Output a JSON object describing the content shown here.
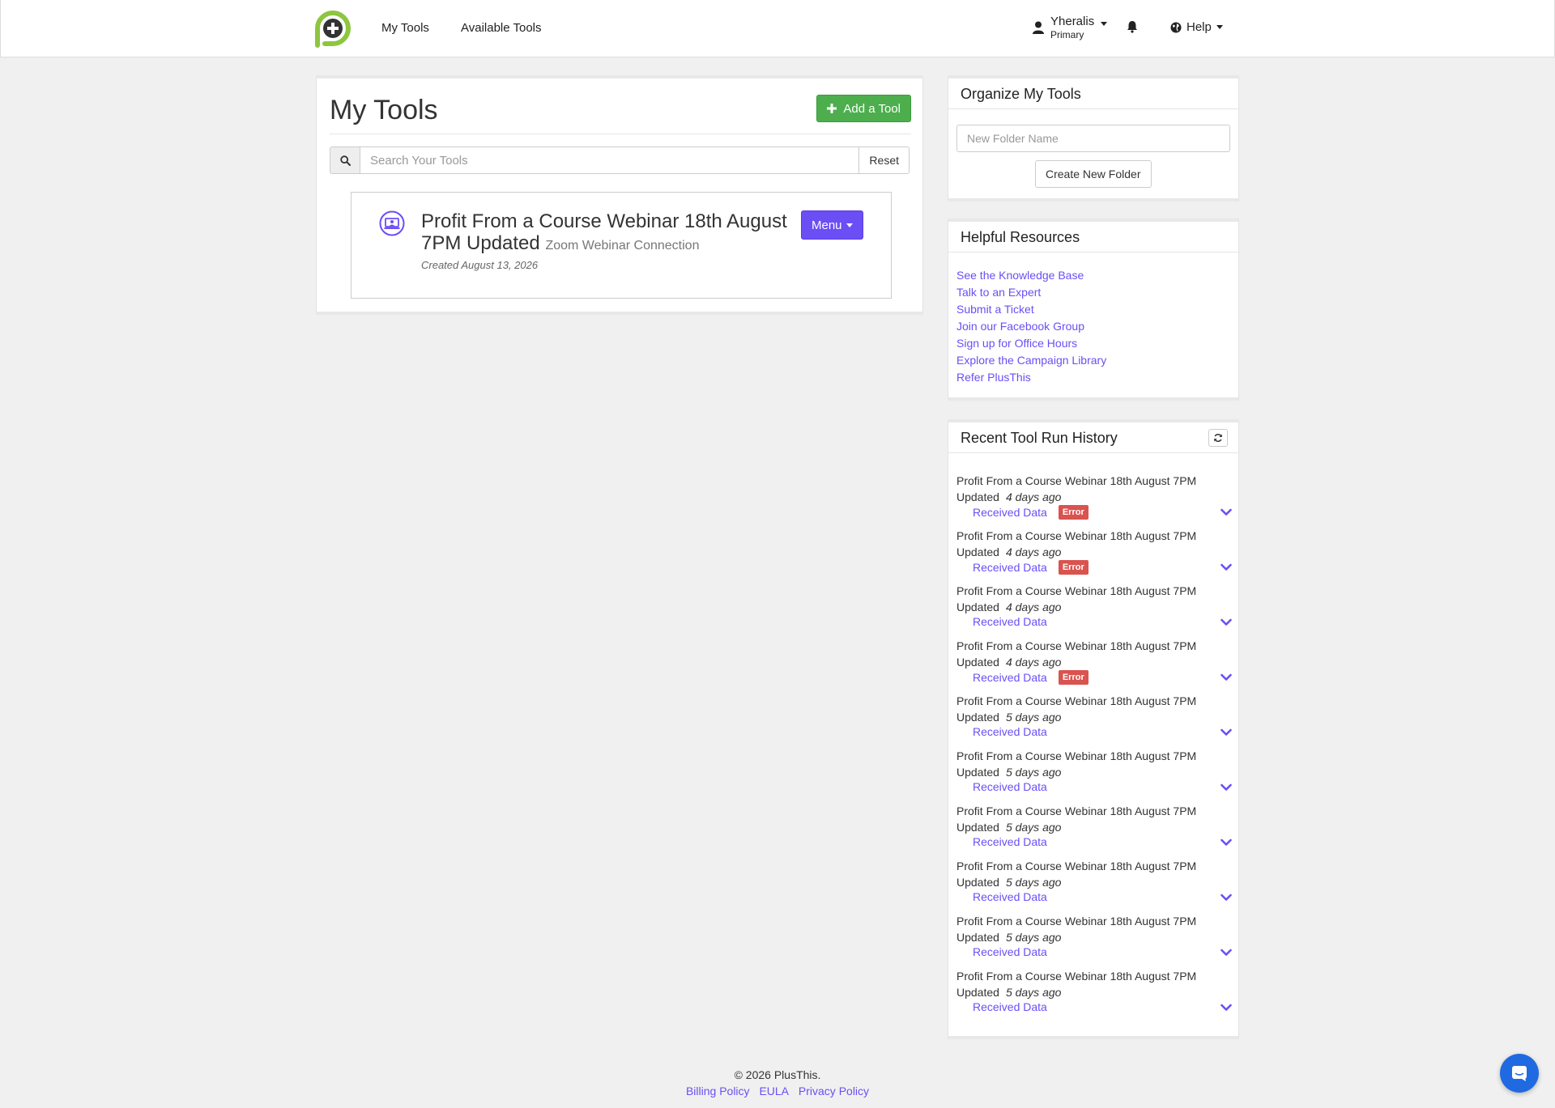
{
  "nav": {
    "my_tools": "My Tools",
    "available_tools": "Available Tools",
    "user_name": "Yheralis",
    "user_role": "Primary",
    "help": "Help"
  },
  "main": {
    "title": "My Tools",
    "add_tool": "Add a Tool",
    "search_placeholder": "Search Your Tools",
    "reset": "Reset",
    "tool": {
      "name": "Profit From a Course Webinar 18th August 7PM Updated",
      "type": "Zoom Webinar Connection",
      "created": "Created August 13, 2026",
      "menu": "Menu"
    }
  },
  "organize": {
    "title": "Organize My Tools",
    "folder_placeholder": "New Folder Name",
    "create_button": "Create New Folder"
  },
  "resources": {
    "title": "Helpful Resources",
    "links": [
      "See the Knowledge Base",
      "Talk to an Expert",
      "Submit a Ticket",
      "Join our Facebook Group",
      "Sign up for Office Hours",
      "Explore the Campaign Library",
      "Refer PlusThis"
    ]
  },
  "history": {
    "title": "Recent Tool Run History",
    "runs": [
      {
        "name": "Profit From a Course Webinar 18th August 7PM Updated",
        "time": "4 days ago",
        "status": "Received Data",
        "badge": "Error"
      },
      {
        "name": "Profit From a Course Webinar 18th August 7PM Updated",
        "time": "4 days ago",
        "status": "Received Data",
        "badge": "Error"
      },
      {
        "name": "Profit From a Course Webinar 18th August 7PM Updated",
        "time": "4 days ago",
        "status": "Received Data",
        "badge": ""
      },
      {
        "name": "Profit From a Course Webinar 18th August 7PM Updated",
        "time": "4 days ago",
        "status": "Received Data",
        "badge": "Error"
      },
      {
        "name": "Profit From a Course Webinar 18th August 7PM Updated",
        "time": "5 days ago",
        "status": "Received Data",
        "badge": ""
      },
      {
        "name": "Profit From a Course Webinar 18th August 7PM Updated",
        "time": "5 days ago",
        "status": "Received Data",
        "badge": ""
      },
      {
        "name": "Profit From a Course Webinar 18th August 7PM Updated",
        "time": "5 days ago",
        "status": "Received Data",
        "badge": ""
      },
      {
        "name": "Profit From a Course Webinar 18th August 7PM Updated",
        "time": "5 days ago",
        "status": "Received Data",
        "badge": ""
      },
      {
        "name": "Profit From a Course Webinar 18th August 7PM Updated",
        "time": "5 days ago",
        "status": "Received Data",
        "badge": ""
      },
      {
        "name": "Profit From a Course Webinar 18th August 7PM Updated",
        "time": "5 days ago",
        "status": "Received Data",
        "badge": ""
      }
    ]
  },
  "footer": {
    "copyright": "© 2026 PlusThis.",
    "links": [
      "Billing Policy",
      "EULA",
      "Privacy Policy"
    ]
  },
  "colors": {
    "brand_green": "#8dc63f",
    "accent_purple": "#6c4ef5",
    "add_button_green": "#4cae4c",
    "error_red": "#d9534f",
    "chat_blue": "#1f6ae0"
  },
  "icons": {
    "logo": "plusthis-logo",
    "user": "user-icon",
    "bell": "bell-icon",
    "globe": "globe-icon",
    "search": "search-icon",
    "tool_type": "webinar-icon",
    "refresh": "refresh-icon",
    "expand": "chevron-down-icon",
    "chat": "chat-icon"
  }
}
